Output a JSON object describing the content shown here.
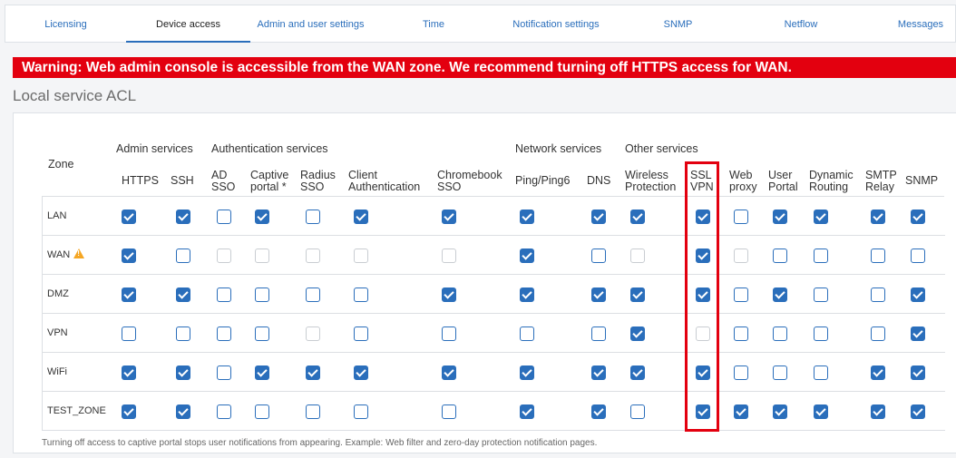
{
  "tabs": [
    {
      "label": "Licensing",
      "active": false
    },
    {
      "label": "Device access",
      "active": true
    },
    {
      "label": "Admin and user settings",
      "active": false
    },
    {
      "label": "Time",
      "active": false
    },
    {
      "label": "Notification settings",
      "active": false
    },
    {
      "label": "SNMP",
      "active": false
    },
    {
      "label": "Netflow",
      "active": false
    },
    {
      "label": "Messages",
      "active": false
    }
  ],
  "warning": "Warning: Web admin console is accessible from the WAN zone. We recommend turning off HTTPS access for WAN.",
  "section_title": "Local service ACL",
  "table": {
    "zone_header": "Zone",
    "groups": [
      "Admin services",
      "Authentication services",
      "Network services",
      "Other services"
    ],
    "columns": [
      {
        "line1": "HTTPS",
        "line2": ""
      },
      {
        "line1": "SSH",
        "line2": ""
      },
      {
        "line1": "AD",
        "line2": "SSO"
      },
      {
        "line1": "Captive",
        "line2": "portal *"
      },
      {
        "line1": "Radius",
        "line2": "SSO"
      },
      {
        "line1": "Client",
        "line2": "Authentication"
      },
      {
        "line1": "Chromebook",
        "line2": "SSO"
      },
      {
        "line1": "Ping/Ping6",
        "line2": ""
      },
      {
        "line1": "DNS",
        "line2": ""
      },
      {
        "line1": "Wireless",
        "line2": "Protection"
      },
      {
        "line1": "SSL",
        "line2": "VPN"
      },
      {
        "line1": "Web",
        "line2": "proxy"
      },
      {
        "line1": "User",
        "line2": "Portal"
      },
      {
        "line1": "Dynamic",
        "line2": "Routing"
      },
      {
        "line1": "SMTP",
        "line2": "Relay"
      },
      {
        "line1": "SNMP",
        "line2": ""
      }
    ],
    "rows": [
      {
        "zone": "LAN",
        "warn": false,
        "states": [
          "on",
          "on",
          "off",
          "on",
          "off",
          "on",
          "on",
          "on",
          "on",
          "on",
          "on",
          "off",
          "on",
          "on",
          "on",
          "on"
        ]
      },
      {
        "zone": "WAN",
        "warn": true,
        "states": [
          "on",
          "off",
          "dis",
          "dis",
          "dis",
          "dis",
          "dis",
          "on",
          "off",
          "dis",
          "on",
          "dis",
          "off",
          "off",
          "off",
          "off"
        ]
      },
      {
        "zone": "DMZ",
        "warn": false,
        "states": [
          "on",
          "on",
          "off",
          "off",
          "off",
          "off",
          "on",
          "on",
          "on",
          "on",
          "on",
          "off",
          "on",
          "off",
          "off",
          "on"
        ]
      },
      {
        "zone": "VPN",
        "warn": false,
        "states": [
          "off",
          "off",
          "off",
          "off",
          "dis",
          "off",
          "off",
          "off",
          "off",
          "on",
          "dis",
          "off",
          "off",
          "off",
          "off",
          "on"
        ]
      },
      {
        "zone": "WiFi",
        "warn": false,
        "states": [
          "on",
          "on",
          "off",
          "on",
          "on",
          "on",
          "on",
          "on",
          "on",
          "on",
          "on",
          "off",
          "off",
          "off",
          "on",
          "on"
        ]
      },
      {
        "zone": "TEST_ZONE",
        "warn": false,
        "states": [
          "on",
          "on",
          "off",
          "off",
          "off",
          "off",
          "off",
          "on",
          "on",
          "off",
          "on",
          "on",
          "on",
          "on",
          "on",
          "on"
        ]
      }
    ]
  },
  "footnote": "Turning off access to captive portal stops user notifications from appearing. Example: Web filter and zero-day protection notification pages."
}
